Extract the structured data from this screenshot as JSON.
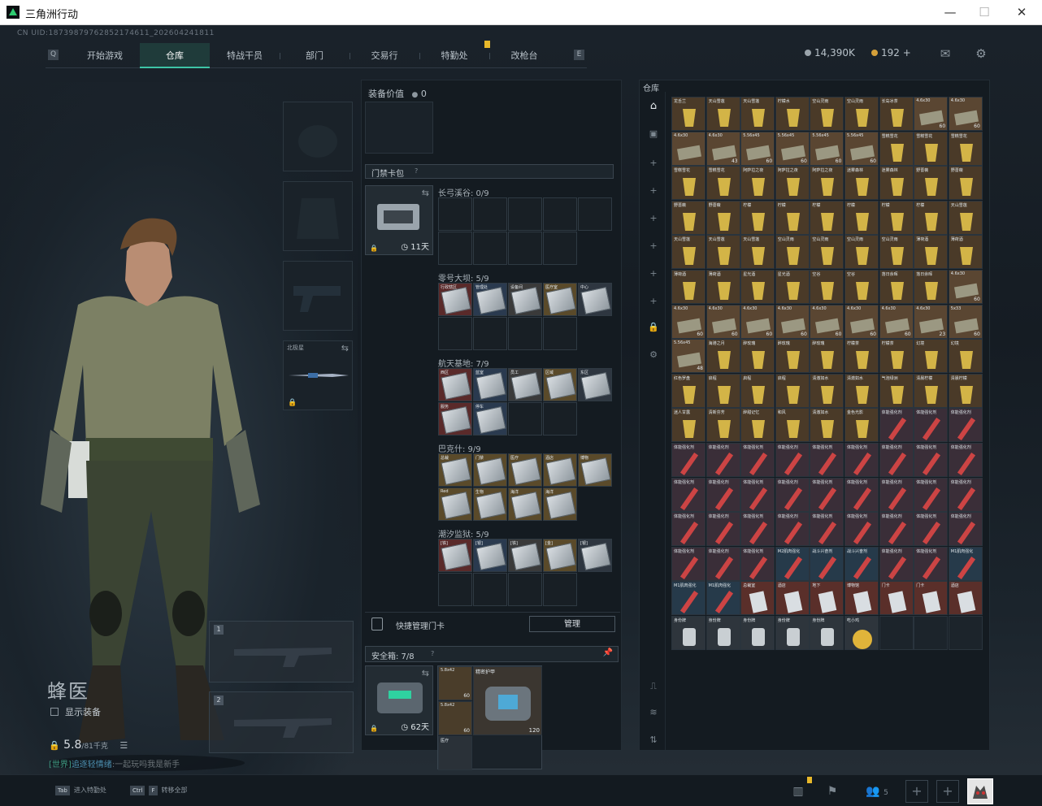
{
  "window": {
    "title": "三角洲行动"
  },
  "header": {
    "uid": "CN UID:18739879762852174611_202604241811",
    "tabs": [
      "开始游戏",
      "仓库",
      "特战干员",
      "部门",
      "交易行",
      "特勤处",
      "改枪台"
    ],
    "active_tab": "仓库",
    "currency_a": "14,390K",
    "currency_b": "192",
    "currency_b_plus": "+"
  },
  "operator": {
    "name": "蜂医",
    "show_equipment": "显示装备",
    "weight_value": "5.8",
    "weight_max": "/81千克",
    "knife_label": "北极星",
    "weapon_slot_1": "1",
    "weapon_slot_2": "2"
  },
  "chat": {
    "channel": "[世界]",
    "sender": "追逐轻情绪",
    "message": ":一起玩吗我是新手"
  },
  "equipment": {
    "value_label": "装备价值",
    "value": "0"
  },
  "keycard_bag": {
    "title": "门禁卡包",
    "days": "11天",
    "groups": [
      {
        "label": "长弓溪谷: 0/9",
        "cards": []
      },
      {
        "label": "零号大坝: 5/9",
        "cards": [
          "行政辖区",
          "管理处",
          "设备间",
          "医疗室",
          "中心"
        ]
      },
      {
        "label": "航天基地: 7/9",
        "cards": [
          "西区",
          "蓝室",
          "员工",
          "区域",
          "东区",
          "服务",
          "停车"
        ]
      },
      {
        "label": "巴克什: 9/9",
        "cards": [
          "总裁",
          "门禁",
          "医疗",
          "酒店",
          "博物",
          "Red",
          "生物",
          "海洋",
          "海洋"
        ]
      },
      {
        "label": "潮汐监狱: 5/9",
        "cards": [
          "[铁]",
          "[银]",
          "[铁]",
          "[金]",
          "[银]"
        ]
      }
    ],
    "manage_label": "快捷管理门卡",
    "manage_button": "管理"
  },
  "safebox": {
    "title": "安全箱: 7/8",
    "days": "62天",
    "items": [
      {
        "name": "5.8x42",
        "count": "60"
      },
      {
        "name": "5.8x42",
        "count": "60"
      },
      {
        "name": "精密护甲",
        "count": "120"
      },
      {
        "name": "医疗",
        "count": ""
      }
    ]
  },
  "warehouse": {
    "title": "仓库",
    "rows": [
      [
        "龙舌兰",
        "天山雪莲",
        "天山雪莲",
        "柠檬水",
        "空山灵雨",
        "空山灵雨",
        "长岛冰茶",
        "4.6x30",
        "4.6x30"
      ],
      [
        "4.6x30",
        "4.6x30",
        "5.56x45",
        "5.56x45",
        "5.56x45",
        "5.56x45",
        "雪糕雪花",
        "雪糕雪花",
        "雪糕雪花"
      ],
      [
        "雪糕雪花",
        "雪糕雪花",
        "阿萨拉之夜",
        "阿萨拉之夜",
        "阿萨拉之夜",
        "迷雾森林",
        "迷雾森林",
        "野蔷薇",
        "野蔷薇"
      ],
      [
        "野蔷薇",
        "野蔷薇",
        "柠檬",
        "柠檬",
        "柠檬",
        "柠檬",
        "柠檬",
        "柠檬",
        "天山雪莲"
      ],
      [
        "天山雪莲",
        "天山雪莲",
        "天山雪莲",
        "空山灵雨",
        "空山灵雨",
        "空山灵雨",
        "空山灵雨",
        "薄荷酒",
        "薄荷酒"
      ],
      [
        "薄荷酒",
        "薄荷酒",
        "星光酒",
        "星光酒",
        "空谷",
        "空谷",
        "落日余晖",
        "落日余晖",
        "4.6x30"
      ],
      [
        "4.6x30",
        "4.6x30",
        "4.6x30",
        "4.6x30",
        "4.6x30",
        "4.6x30",
        "4.6x30",
        "4.6x30",
        "5x33"
      ],
      [
        "5.56x45",
        "海港之月",
        "醉玫瑰",
        "醉玫瑰",
        "醉玫瑰",
        "柠檬茶",
        "柠檬茶",
        "幻境",
        "幻境"
      ],
      [
        "红色罗盘",
        "启程",
        "启程",
        "启程",
        "清澈如水",
        "清澈如水",
        "气泡绿洲",
        "清晨柠檬",
        "清晨柠檬"
      ],
      [
        "迷人甘露",
        "清新芬芳",
        "醉甜记忆",
        "和风",
        "清澈如水",
        "金色光影",
        "体能强化剂",
        "体能强化剂",
        "体能强化剂"
      ],
      [
        "体能强化剂",
        "体能强化剂",
        "体能强化剂",
        "体能强化剂",
        "体能强化剂",
        "体能强化剂",
        "体能强化剂",
        "体能强化剂",
        "体能强化剂"
      ],
      [
        "体能强化剂",
        "体能强化剂",
        "体能强化剂",
        "体能强化剂",
        "体能强化剂",
        "体能强化剂",
        "体能强化剂",
        "体能强化剂",
        "体能强化剂"
      ],
      [
        "体能强化剂",
        "体能强化剂",
        "体能强化剂",
        "体能强化剂",
        "体能强化剂",
        "体能强化剂",
        "体能强化剂",
        "体能强化剂",
        "体能强化剂"
      ],
      [
        "体能强化剂",
        "体能强化剂",
        "体能强化剂",
        "M2肌肉强化",
        "战斗兴奋剂",
        "战斗兴奋剂",
        "体能强化剂",
        "体能强化剂",
        "M1肌肉强化"
      ],
      [
        "M1肌肉强化",
        "M1肌肉强化",
        "总裁室",
        "酒店",
        "地下",
        "博物馆",
        "门卡",
        "门卡",
        "酒店"
      ],
      [
        "身份牌",
        "身份牌",
        "身份牌",
        "身份牌",
        "身份牌",
        "吃小鸡",
        "",
        "",
        ""
      ]
    ],
    "counts": {
      "0-7": "60",
      "0-8": "60",
      "1-1": "43",
      "1-2": "60",
      "1-3": "60",
      "1-4": "60",
      "1-5": "60",
      "5-8": "60",
      "6-0": "60",
      "6-1": "60",
      "6-2": "60",
      "6-3": "60",
      "6-4": "60",
      "6-5": "60",
      "6-6": "60",
      "6-7": "23",
      "6-8": "60",
      "7-0": "48"
    }
  },
  "bottom": {
    "hint1_key": "Tab",
    "hint1_text": "进入特勤处",
    "hint2_key": "Ctrl",
    "hint2_key2": "F",
    "hint2_text": "转移全部",
    "friends_count": "5"
  }
}
